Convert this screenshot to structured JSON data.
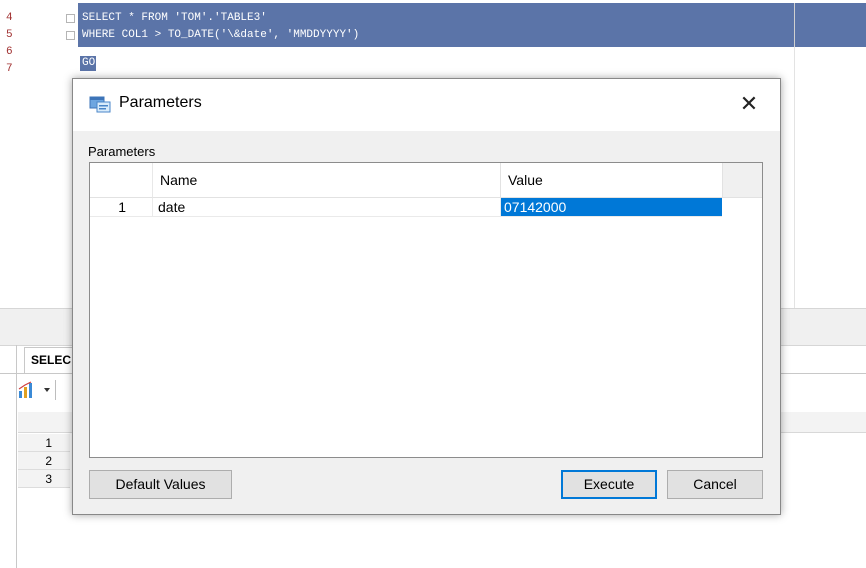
{
  "editor": {
    "line_numbers": [
      "4",
      "5",
      "6",
      "7"
    ],
    "lines": [
      "SELECT * FROM 'TOM'.'TABLE3'",
      "WHERE COL1 > TO_DATE('\\&date', 'MMDDYYYY')",
      "GO"
    ]
  },
  "results": {
    "tab_label": "SELEC",
    "row_numbers": [
      "1",
      "2",
      "3"
    ]
  },
  "dialog": {
    "title": "Parameters",
    "close_glyph": "✕",
    "group_label": "Parameters",
    "columns": {
      "name": "Name",
      "value": "Value"
    },
    "rows": [
      {
        "num": "1",
        "name": "date",
        "value": "07142000"
      }
    ],
    "buttons": {
      "default_values": "Default Values",
      "execute": "Execute",
      "cancel": "Cancel"
    }
  },
  "colors": {
    "selection": "#5b74a8",
    "focus_accent": "#0078d7"
  },
  "icons": {
    "dialog": "parameters-icon",
    "toolbar": "chart-icon",
    "close": "close-icon"
  }
}
